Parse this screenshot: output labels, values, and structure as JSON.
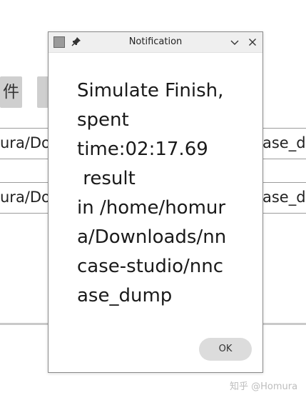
{
  "background": {
    "button_label": "件",
    "field1": {
      "left_text": "ura/Do",
      "right_text": "ase_d"
    },
    "field2": {
      "left_text": "ura/Do",
      "right_text": "ase_d"
    }
  },
  "dialog": {
    "title": "Notification",
    "message": "Simulate Finish,\nspent\ntime:02:17.69\n result\nin /home/homur\na/Downloads/nn\ncase-studio/nnc\nase_dump",
    "ok_label": "OK",
    "icons": {
      "app": "app-icon",
      "pin": "pin-icon",
      "minimize": "chevron-down-icon",
      "close": "close-icon"
    }
  },
  "watermark": "知乎 @Homura",
  "colors": {
    "titlebar": "#efefef",
    "button": "#dcdcdc",
    "border": "#8a8a8a"
  }
}
